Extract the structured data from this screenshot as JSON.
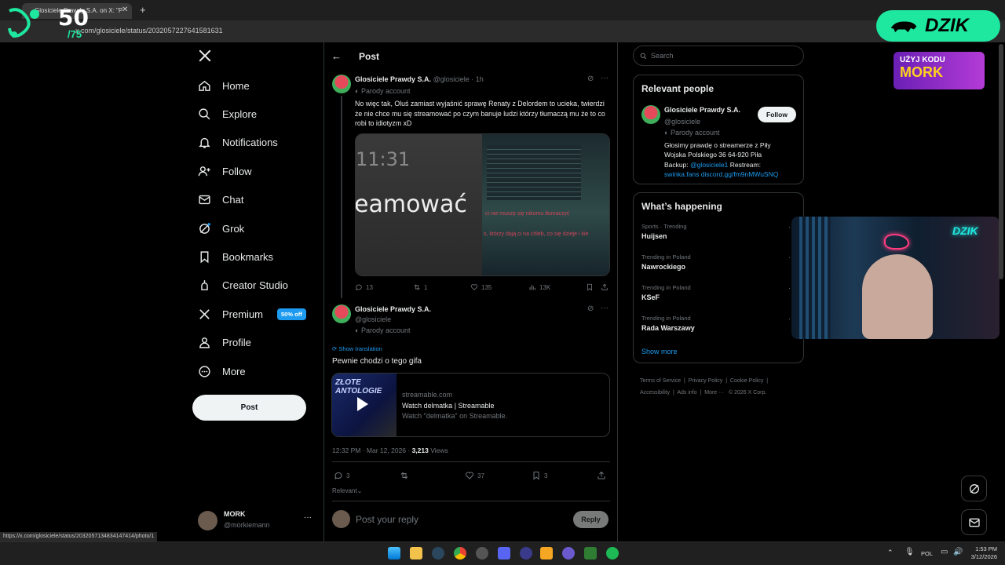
{
  "browser": {
    "tab_title": "Glosiciele Prawdy S.A. on X: \"P",
    "url": "x.com/glosiciele/status/2032057227641581631",
    "status_url": "https://x.com/glosiciele/status/2032057134834147414/photo/1"
  },
  "overlay": {
    "counter_top": "50",
    "counter_bottom": "/75",
    "brand": "DZIK",
    "promo_line1": "UŻYJ KODU",
    "promo_line2": "MORK"
  },
  "sidebar": {
    "items": [
      {
        "label": "Home",
        "icon": "home-icon"
      },
      {
        "label": "Explore",
        "icon": "search-icon"
      },
      {
        "label": "Notifications",
        "icon": "bell-icon"
      },
      {
        "label": "Follow",
        "icon": "follow-icon"
      },
      {
        "label": "Chat",
        "icon": "mail-icon"
      },
      {
        "label": "Grok",
        "icon": "grok-icon"
      },
      {
        "label": "Bookmarks",
        "icon": "bookmark-icon"
      },
      {
        "label": "Creator Studio",
        "icon": "creator-icon"
      },
      {
        "label": "Premium",
        "icon": "x-icon",
        "badge": "50% off"
      },
      {
        "label": "Profile",
        "icon": "profile-icon"
      },
      {
        "label": "More",
        "icon": "more-icon"
      }
    ],
    "post_label": "Post",
    "account": {
      "name": "MORK",
      "handle": "@morkiemann"
    }
  },
  "main": {
    "header_title": "Post",
    "parent": {
      "name": "Glosiciele Prawdy S.A.",
      "handle": "@glosiciele",
      "time": "· 1h",
      "parody": "Parody account",
      "text": "No więc tak, Oluś zamiast wyjaśnić sprawę Renaty z Delordem to ucieka, twierdzi że nie chce mu się streamować po czym banuje ludzi którzy tłumaczą mu że to co robi to idiotyzm xD",
      "image_left_big": "11:31",
      "image_left_word": "eamować",
      "image_right_line1": "ci nie muszę się nikomu tłumaczyć",
      "image_right_line2": "s, którzy dają ci na chleb, co się dzieje i kie",
      "stats": {
        "replies": "13",
        "reposts": "1",
        "likes": "135",
        "views": "13K"
      }
    },
    "focus": {
      "name": "Glosiciele Prawdy S.A.",
      "handle": "@glosiciele",
      "parody": "Parody account",
      "show_translation": "Show translation",
      "text": "Pewnie chodzi o tego gifa",
      "link_domain": "streamable.com",
      "link_title": "Watch delmatka | Streamable",
      "link_desc": "Watch \"delmatka\" on Streamable.",
      "thumb_text": "ZŁOTE ANTOLOGIE",
      "timestamp": "12:32 PM · Mar 12, 2026 · ",
      "views_count": "3,213",
      "views_label": " Views",
      "stats": {
        "replies": "3",
        "likes": "37",
        "bookmarks": "3"
      },
      "sort_label": "Relevant"
    },
    "reply": {
      "placeholder": "Post your reply",
      "button": "Reply"
    }
  },
  "right": {
    "search_placeholder": "Search",
    "relevant_title": "Relevant people",
    "person": {
      "name": "Glosiciele Prawdy S.A.",
      "handle": "@glosiciele",
      "parody": "Parody account",
      "follow": "Follow",
      "bio1": "Głosimy prawdę o streamerze z Piły",
      "bio2": "Wojska Polskiego 36 64-920 Piła",
      "bio3_prefix": "Backup: ",
      "bio3_link": "@glosiciele1",
      "bio3_suffix": " Restream:",
      "bio4": "swinka.fans discord.gg/fm9nMWuSNQ"
    },
    "happening_title": "What’s happening",
    "trends": [
      {
        "category": "Sports · Trending",
        "name": "Huijsen"
      },
      {
        "category": "Trending in Poland",
        "name": "Nawrockiego"
      },
      {
        "category": "Trending in Poland",
        "name": "KSeF"
      },
      {
        "category": "Trending in Poland",
        "name": "Rada Warszawy"
      }
    ],
    "show_more": "Show more",
    "footer": {
      "l1": "Terms of Service",
      "l2": "Privacy Policy",
      "l3": "Cookie Policy",
      "l4": "Accessibility",
      "l5": "Ads info",
      "l6": "More ···",
      "l7": "© 2026 X Corp."
    }
  },
  "taskbar": {
    "lang": "POL",
    "time": "1:53 PM",
    "date": "3/12/2026"
  },
  "colors": {
    "accent": "#1d9bf0",
    "brand_green": "#1ee8a0",
    "bg": "#000000"
  }
}
